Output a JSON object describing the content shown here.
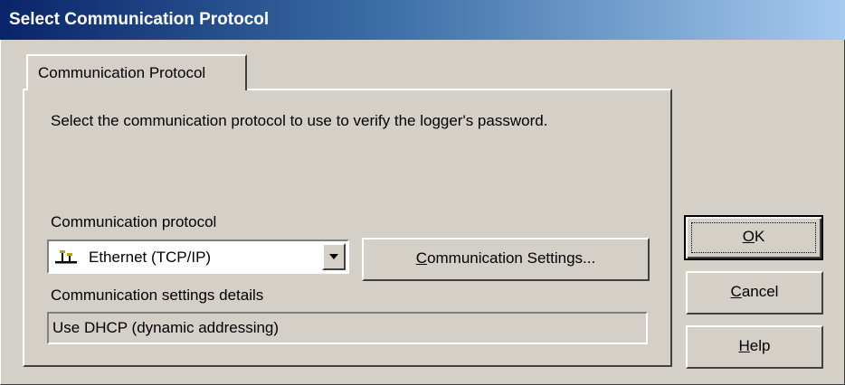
{
  "window": {
    "title": "Select Communication Protocol",
    "title_bar_color": "#0a246a",
    "background_color": "#d4d0c8"
  },
  "tabs": [
    {
      "label": "Communication Protocol",
      "selected": true
    }
  ],
  "panel": {
    "intro_text": "Select the communication protocol to use to verify the logger's password.",
    "protocol_label": "Communication protocol",
    "protocol_select": {
      "value": "Ethernet (TCP/IP)",
      "icon": "ethernet-icon"
    },
    "settings_button": {
      "mnemonic": "C",
      "rest": "ommunication Settings..."
    },
    "details_label": "Communication settings details",
    "details_value": "Use DHCP (dynamic addressing)"
  },
  "buttons": {
    "ok": {
      "mnemonic": "O",
      "rest": "K"
    },
    "cancel": {
      "mnemonic": "C",
      "rest": "ancel"
    },
    "help": {
      "mnemonic": "H",
      "rest": "elp"
    }
  }
}
